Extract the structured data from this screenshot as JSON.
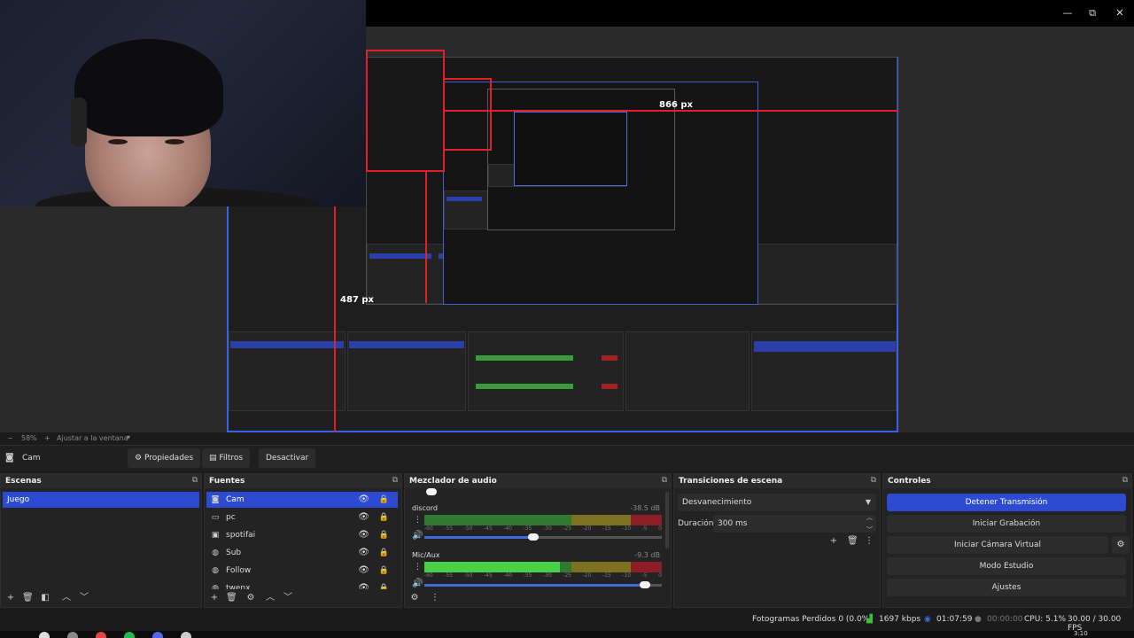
{
  "window": {
    "minimize_label": "—",
    "maximize_label": "⧉",
    "close_label": "✕"
  },
  "preview": {
    "measure_horizontal": "866 px",
    "measure_vertical": "487 px"
  },
  "zoombar": {
    "zoom_value": "58%",
    "fit_label": "Ajustar a la ventana"
  },
  "source_bar": {
    "selected_source": "Cam",
    "properties_label": "Propiedades",
    "filters_label": "Filtros",
    "deactivate_label": "Desactivar"
  },
  "scenes": {
    "title": "Escenas",
    "items": [
      "Juego"
    ]
  },
  "sources": {
    "title": "Fuentes",
    "items": [
      {
        "label": "Cam",
        "icon": "camera-icon",
        "selected": true
      },
      {
        "label": "pc",
        "icon": "monitor-icon",
        "selected": false
      },
      {
        "label": "spotifai",
        "icon": "window-icon",
        "selected": false
      },
      {
        "label": "Sub",
        "icon": "globe-icon",
        "selected": false
      },
      {
        "label": "Follow",
        "icon": "globe-icon",
        "selected": false
      },
      {
        "label": "twenx",
        "icon": "globe-icon",
        "selected": false
      }
    ]
  },
  "mixer": {
    "title": "Mezclador de audio",
    "channels": [
      {
        "name": "discord",
        "db": "-38.5 dB",
        "level": 0.0,
        "volume": 0.46
      },
      {
        "name": "Mic/Aux",
        "db": "-9.3 dB",
        "level": 0.57,
        "volume": 0.93
      }
    ],
    "ticks": [
      "-60",
      "-55",
      "-50",
      "-45",
      "-40",
      "-35",
      "-30",
      "-25",
      "-20",
      "-15",
      "-10",
      "-5",
      "0"
    ]
  },
  "transitions": {
    "title": "Transiciones de escena",
    "selected": "Desvanecimiento",
    "duration_label": "Duración",
    "duration_value": "300 ms"
  },
  "controls": {
    "title": "Controles",
    "stop_stream": "Detener Transmisión",
    "start_recording": "Iniciar Grabación",
    "start_virtual_cam": "Iniciar Cámara Virtual",
    "studio_mode": "Modo Estudio",
    "settings": "Ajustes"
  },
  "status": {
    "dropped_frames": "Fotogramas Perdidos 0 (0.0%)",
    "bitrate": "1697 kbps",
    "stream_time": "01:07:59",
    "record_time": "00:00:00",
    "cpu": "CPU: 5.1%",
    "fps": "30.00 / 30.00 FPS"
  },
  "taskbar": {
    "time": "3:10"
  },
  "colors": {
    "accent": "#2d4bd0",
    "measure_red": "#e0202a",
    "meter_green": "#48d048"
  }
}
